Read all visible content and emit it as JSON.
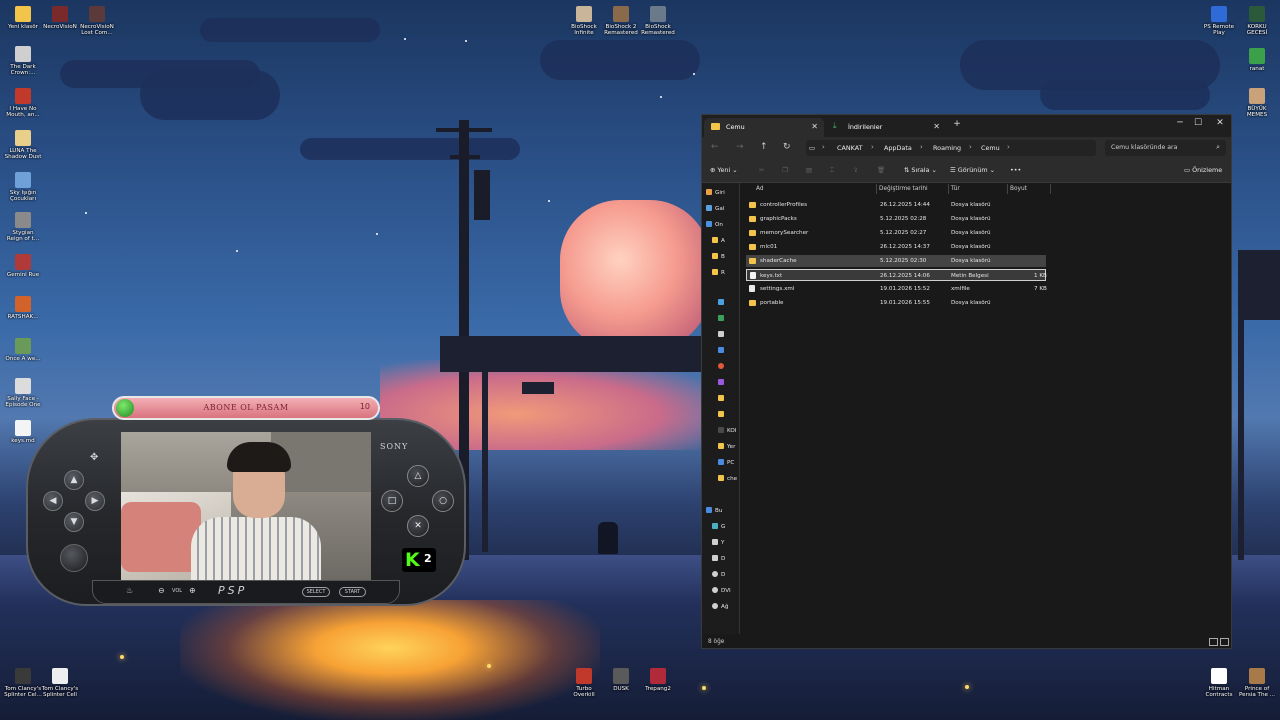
{
  "desktop": {
    "left_icons": [
      {
        "label": "Yeni klasör",
        "color": "#f2c54a"
      },
      {
        "label": "The Dark\nCrown:...",
        "color": "#cfcfcf"
      },
      {
        "label": "I Have No\nMouth, an...",
        "color": "#c0392b"
      },
      {
        "label": "LUNA The\nShadow Dust",
        "color": "#e8d08a"
      },
      {
        "label": "Sky Işığın\nÇocukları",
        "color": "#6fa0d8"
      },
      {
        "label": "Stygian\nReign of t...",
        "color": "#8a8a8a"
      },
      {
        "label": "Gemini Rue",
        "color": "#b03a3a"
      },
      {
        "label": "RATSHAK...",
        "color": "#d0622a"
      },
      {
        "label": "Once A we...",
        "color": "#6a9a5a"
      },
      {
        "label": "Sally Face -\nEpisode One",
        "color": "#dcdcdc"
      },
      {
        "label": "keys.md",
        "color": "#f4f4f4"
      }
    ],
    "top_icons": [
      {
        "label": "NecroVisioN",
        "color": "#7a2a2a"
      },
      {
        "label": "NecroVisioN\nLost Com...",
        "color": "#5a3a3a"
      },
      {
        "label": "BioShock\nInfinite",
        "color": "#c8b59a"
      },
      {
        "label": "BioShock 2\nRemastered",
        "color": "#8a6a4a"
      },
      {
        "label": "BioShock\nRemastered",
        "color": "#6a7a8a"
      }
    ],
    "right_icons": [
      {
        "label": "PS Remote\nPlay",
        "color": "#2f6bd6"
      },
      {
        "label": "KORKU\nGECESİ",
        "color": "#2a5a3a"
      },
      {
        "label": "ranat",
        "color": "#3aa04a"
      },
      {
        "label": "BÜYÜK\nMEMES",
        "color": "#c9a27a"
      }
    ],
    "bottom_icons": [
      {
        "label": "Tom Clancy's\nSplinter Cel...",
        "color": "#3a3a3a"
      },
      {
        "label": "Tom Clancy's\nSplinter Cell",
        "color": "#eeeeee"
      },
      {
        "label": "Turbo\nOverkill",
        "color": "#c0392b"
      },
      {
        "label": "DUSK",
        "color": "#5a5a5a"
      },
      {
        "label": "Trepang2",
        "color": "#b02a3a"
      },
      {
        "label": "Hitman\nContracts",
        "color": "#ffffff"
      },
      {
        "label": "Prince of\nPersia The ...",
        "color": "#a87a4a"
      }
    ]
  },
  "explorer": {
    "tabs": [
      {
        "label": "Cemu"
      },
      {
        "label": "İndirilenler"
      }
    ],
    "new_tab": "+",
    "window_controls": {
      "minimize": "─",
      "maximize": "☐",
      "close": "✕"
    },
    "nav": {
      "back": "←",
      "forward": "→",
      "up": "↑",
      "refresh": "↻",
      "pc": "▭",
      "more": "›"
    },
    "breadcrumb": [
      "CANKAT",
      "AppData",
      "Roaming",
      "Cemu"
    ],
    "search_placeholder": "Cemu klasöründe ara",
    "toolbar": {
      "new": "Yeni",
      "sort": "Sırala",
      "view": "Görünüm",
      "more": "•••",
      "preview": "Önizleme"
    },
    "columns": {
      "name": "Ad",
      "date": "Değiştirme tarihi",
      "type": "Tür",
      "size": "Boyut"
    },
    "files": [
      {
        "name": "controllerProfiles",
        "date": "26.12.2025 14:44",
        "type": "Dosya klasörü",
        "size": "",
        "kind": "folder"
      },
      {
        "name": "graphicPacks",
        "date": "5.12.2025 02:28",
        "type": "Dosya klasörü",
        "size": "",
        "kind": "folder"
      },
      {
        "name": "memorySearcher",
        "date": "5.12.2025 02:27",
        "type": "Dosya klasörü",
        "size": "",
        "kind": "folder"
      },
      {
        "name": "mlc01",
        "date": "26.12.2025 14:37",
        "type": "Dosya klasörü",
        "size": "",
        "kind": "folder"
      },
      {
        "name": "shaderCache",
        "date": "5.12.2025 02:30",
        "type": "Dosya klasörü",
        "size": "",
        "kind": "folder"
      },
      {
        "name": "keys.txt",
        "date": "26.12.2025 14:06",
        "type": "Metin Belgesi",
        "size": "1 KB",
        "kind": "doc"
      },
      {
        "name": "settings.xml",
        "date": "19.01.2026 15:52",
        "type": "xmlfile",
        "size": "7 KB",
        "kind": "xml"
      },
      {
        "name": "portable",
        "date": "19.01.2026 15:55",
        "type": "Dosya klasörü",
        "size": "",
        "kind": "folder"
      }
    ],
    "sidebar": [
      {
        "label": "Giri",
        "color": "#e8a04a"
      },
      {
        "label": "Gal",
        "color": "#5aa0e0"
      },
      {
        "label": "On",
        "color": "#4a90e0"
      },
      {
        "label": "A",
        "color": "#f2c54a"
      },
      {
        "label": "B",
        "color": "#f2c54a"
      },
      {
        "label": "R",
        "color": "#f2c54a"
      },
      {
        "label": "",
        "color": "#4aa0e0"
      },
      {
        "label": "",
        "color": "#3aa05a"
      },
      {
        "label": "",
        "color": "#cfcfcf"
      },
      {
        "label": "",
        "color": "#4a8ae0"
      },
      {
        "label": "",
        "color": "#e05a3a"
      },
      {
        "label": "",
        "color": "#9a5ae0"
      },
      {
        "label": "",
        "color": "#f2c54a"
      },
      {
        "label": "",
        "color": "#f2c54a"
      },
      {
        "label": "KOI",
        "color": "#4a4a4a"
      },
      {
        "label": "Yer",
        "color": "#f2c54a"
      },
      {
        "label": "PC",
        "color": "#4a8ae0"
      },
      {
        "label": "che",
        "color": "#f2c54a"
      },
      {
        "label": "Bu",
        "color": "#4a8ae0"
      },
      {
        "label": "G",
        "color": "#4ab0c0"
      },
      {
        "label": "Y",
        "color": "#cfcfcf"
      },
      {
        "label": "D",
        "color": "#cfcfcf"
      },
      {
        "label": "D",
        "color": "#cfcfcf"
      },
      {
        "label": "DVI",
        "color": "#cfcfcf"
      },
      {
        "label": "Ağ",
        "color": "#cfcfcf"
      }
    ],
    "status": "8 öğe"
  },
  "overlay": {
    "banner_text": "ABONE OL PASAM",
    "banner_number": "10",
    "sony": "SONY",
    "psp_logo": "PSP",
    "vol": "VOL",
    "select": "SELECT",
    "start": "START",
    "kick_letter": "K",
    "kick_number": "2"
  }
}
